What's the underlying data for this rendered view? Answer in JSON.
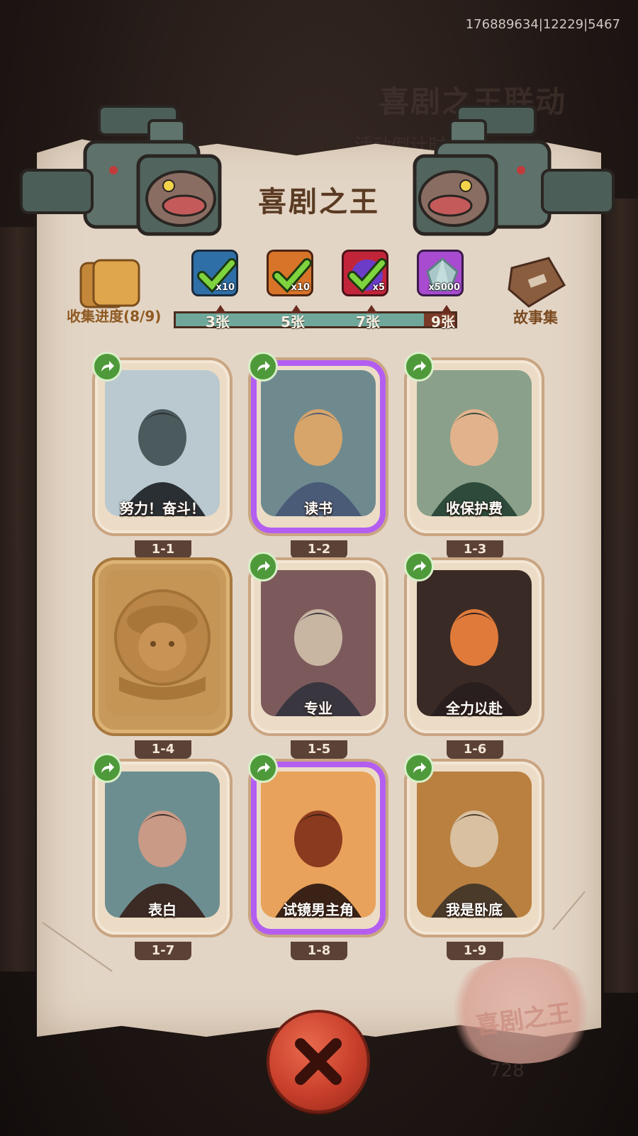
{
  "debug_id": "176889634|12229|5467",
  "title": "喜剧之王",
  "background": {
    "ghost_title": "喜剧之王联动",
    "ghost_sub": "活动倒计时",
    "ghost_num": "728"
  },
  "collection": {
    "label": "收集进度(8/9)",
    "collected": 8,
    "total": 9
  },
  "story": {
    "label": "故事集"
  },
  "progress": {
    "value": 8,
    "max": 9,
    "milestones": [
      {
        "label": "3张",
        "count": 3,
        "reward_qty": "x10",
        "reward_icon": "blue-box-icon",
        "claimed": true
      },
      {
        "label": "5张",
        "count": 5,
        "reward_qty": "x10",
        "reward_icon": "orange-key-icon",
        "claimed": true
      },
      {
        "label": "7张",
        "count": 7,
        "reward_qty": "x5",
        "reward_icon": "magic-orb-icon",
        "claimed": true
      },
      {
        "label": "9张",
        "count": 9,
        "reward_qty": "x5000",
        "reward_icon": "crystal-icon",
        "claimed": false
      }
    ]
  },
  "cards": [
    {
      "name": "努力！奋斗！",
      "badge": "1-1",
      "owned": true,
      "holo": false
    },
    {
      "name": "读书",
      "badge": "1-2",
      "owned": true,
      "holo": true
    },
    {
      "name": "收保护费",
      "badge": "1-3",
      "owned": true,
      "holo": false
    },
    {
      "name": "",
      "badge": "1-4",
      "owned": false,
      "holo": false
    },
    {
      "name": "专业",
      "badge": "1-5",
      "owned": true,
      "holo": false
    },
    {
      "name": "全力以赴",
      "badge": "1-6",
      "owned": true,
      "holo": false
    },
    {
      "name": "表白",
      "badge": "1-7",
      "owned": true,
      "holo": false
    },
    {
      "name": "试镜男主角",
      "badge": "1-8",
      "owned": true,
      "holo": true
    },
    {
      "name": "我是卧底",
      "badge": "1-9",
      "owned": true,
      "holo": false
    }
  ],
  "seal_text": "喜剧之王",
  "colors": {
    "accent_green": "#4e9a3a",
    "progress_fill": "#6fa79b",
    "close_red": "#c83f2b",
    "holo": "#b35ef0"
  }
}
